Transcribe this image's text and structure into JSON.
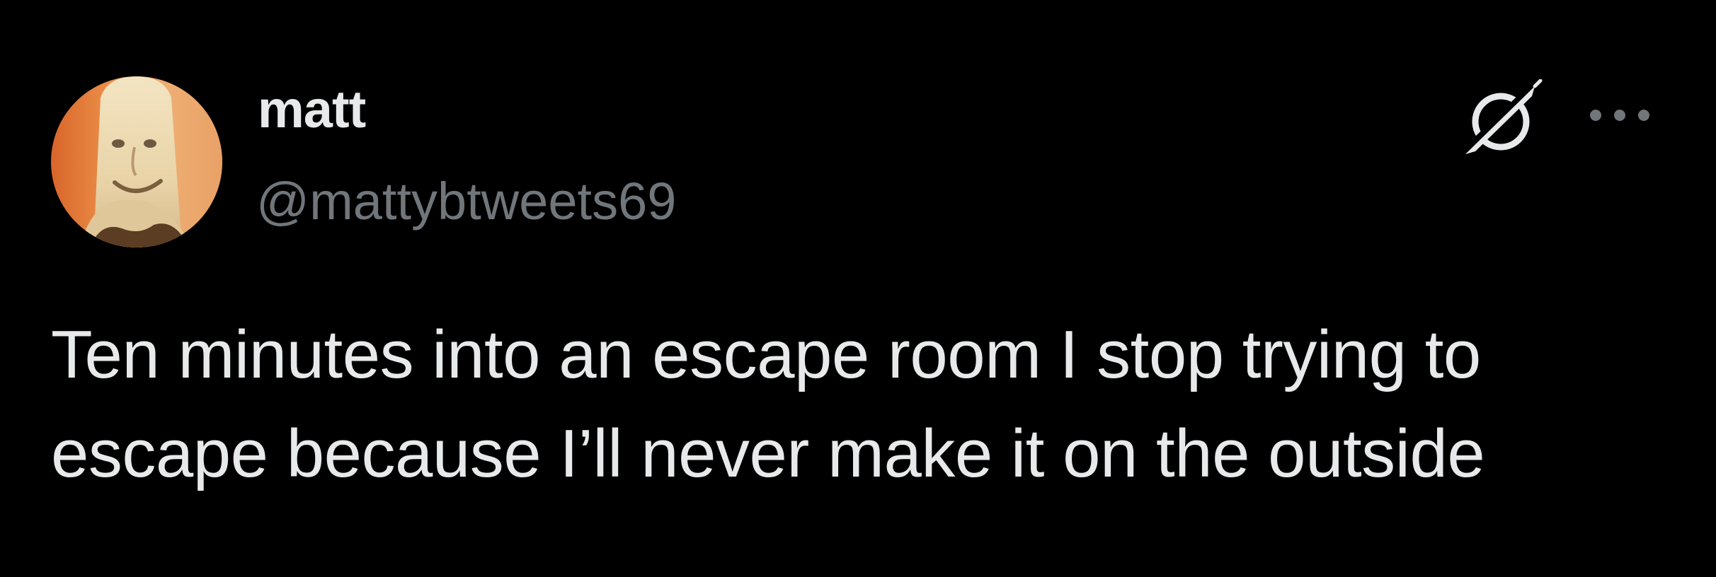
{
  "author": {
    "display_name": "matt",
    "handle": "@mattybtweets69",
    "avatar_icon": "avatar-photo"
  },
  "actions": {
    "grok_icon": "grok-icon",
    "more_icon": "more-options-icon"
  },
  "tweet": {
    "text": "Ten minutes into an escape room I stop trying to escape because I’ll never make it on the outside"
  },
  "colors": {
    "background": "#000000",
    "primary_text": "#e7e9ea",
    "secondary_text": "#71767b"
  }
}
